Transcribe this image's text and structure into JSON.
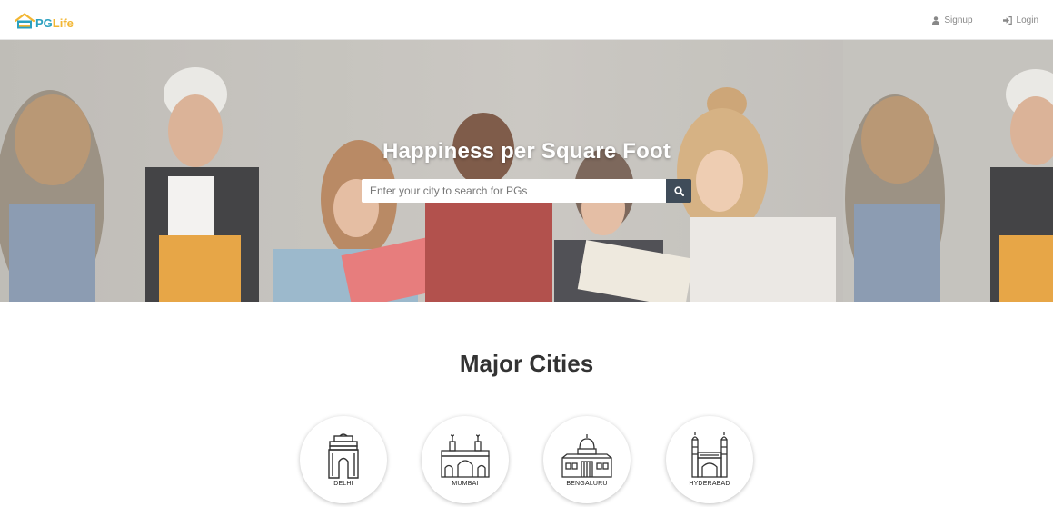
{
  "header": {
    "logo": {
      "pg": "PG",
      "life": "Life"
    },
    "nav": {
      "signup": "Signup",
      "login": "Login"
    }
  },
  "hero": {
    "title": "Happiness per Square Foot",
    "search": {
      "placeholder": "Enter your city to search for PGs",
      "value": "",
      "button_icon": "search-icon"
    }
  },
  "major_cities": {
    "title": "Major Cities",
    "cities": [
      {
        "name": "DELHI",
        "icon": "india-gate-icon"
      },
      {
        "name": "MUMBAI",
        "icon": "gateway-of-india-icon"
      },
      {
        "name": "BENGALURU",
        "icon": "vidhana-soudha-icon"
      },
      {
        "name": "HYDERABAD",
        "icon": "charminar-icon"
      }
    ]
  },
  "colors": {
    "logo_blue": "#2aa0bf",
    "logo_yellow": "#f2b632",
    "search_button": "#3f4c59",
    "nav_text": "#888888"
  }
}
